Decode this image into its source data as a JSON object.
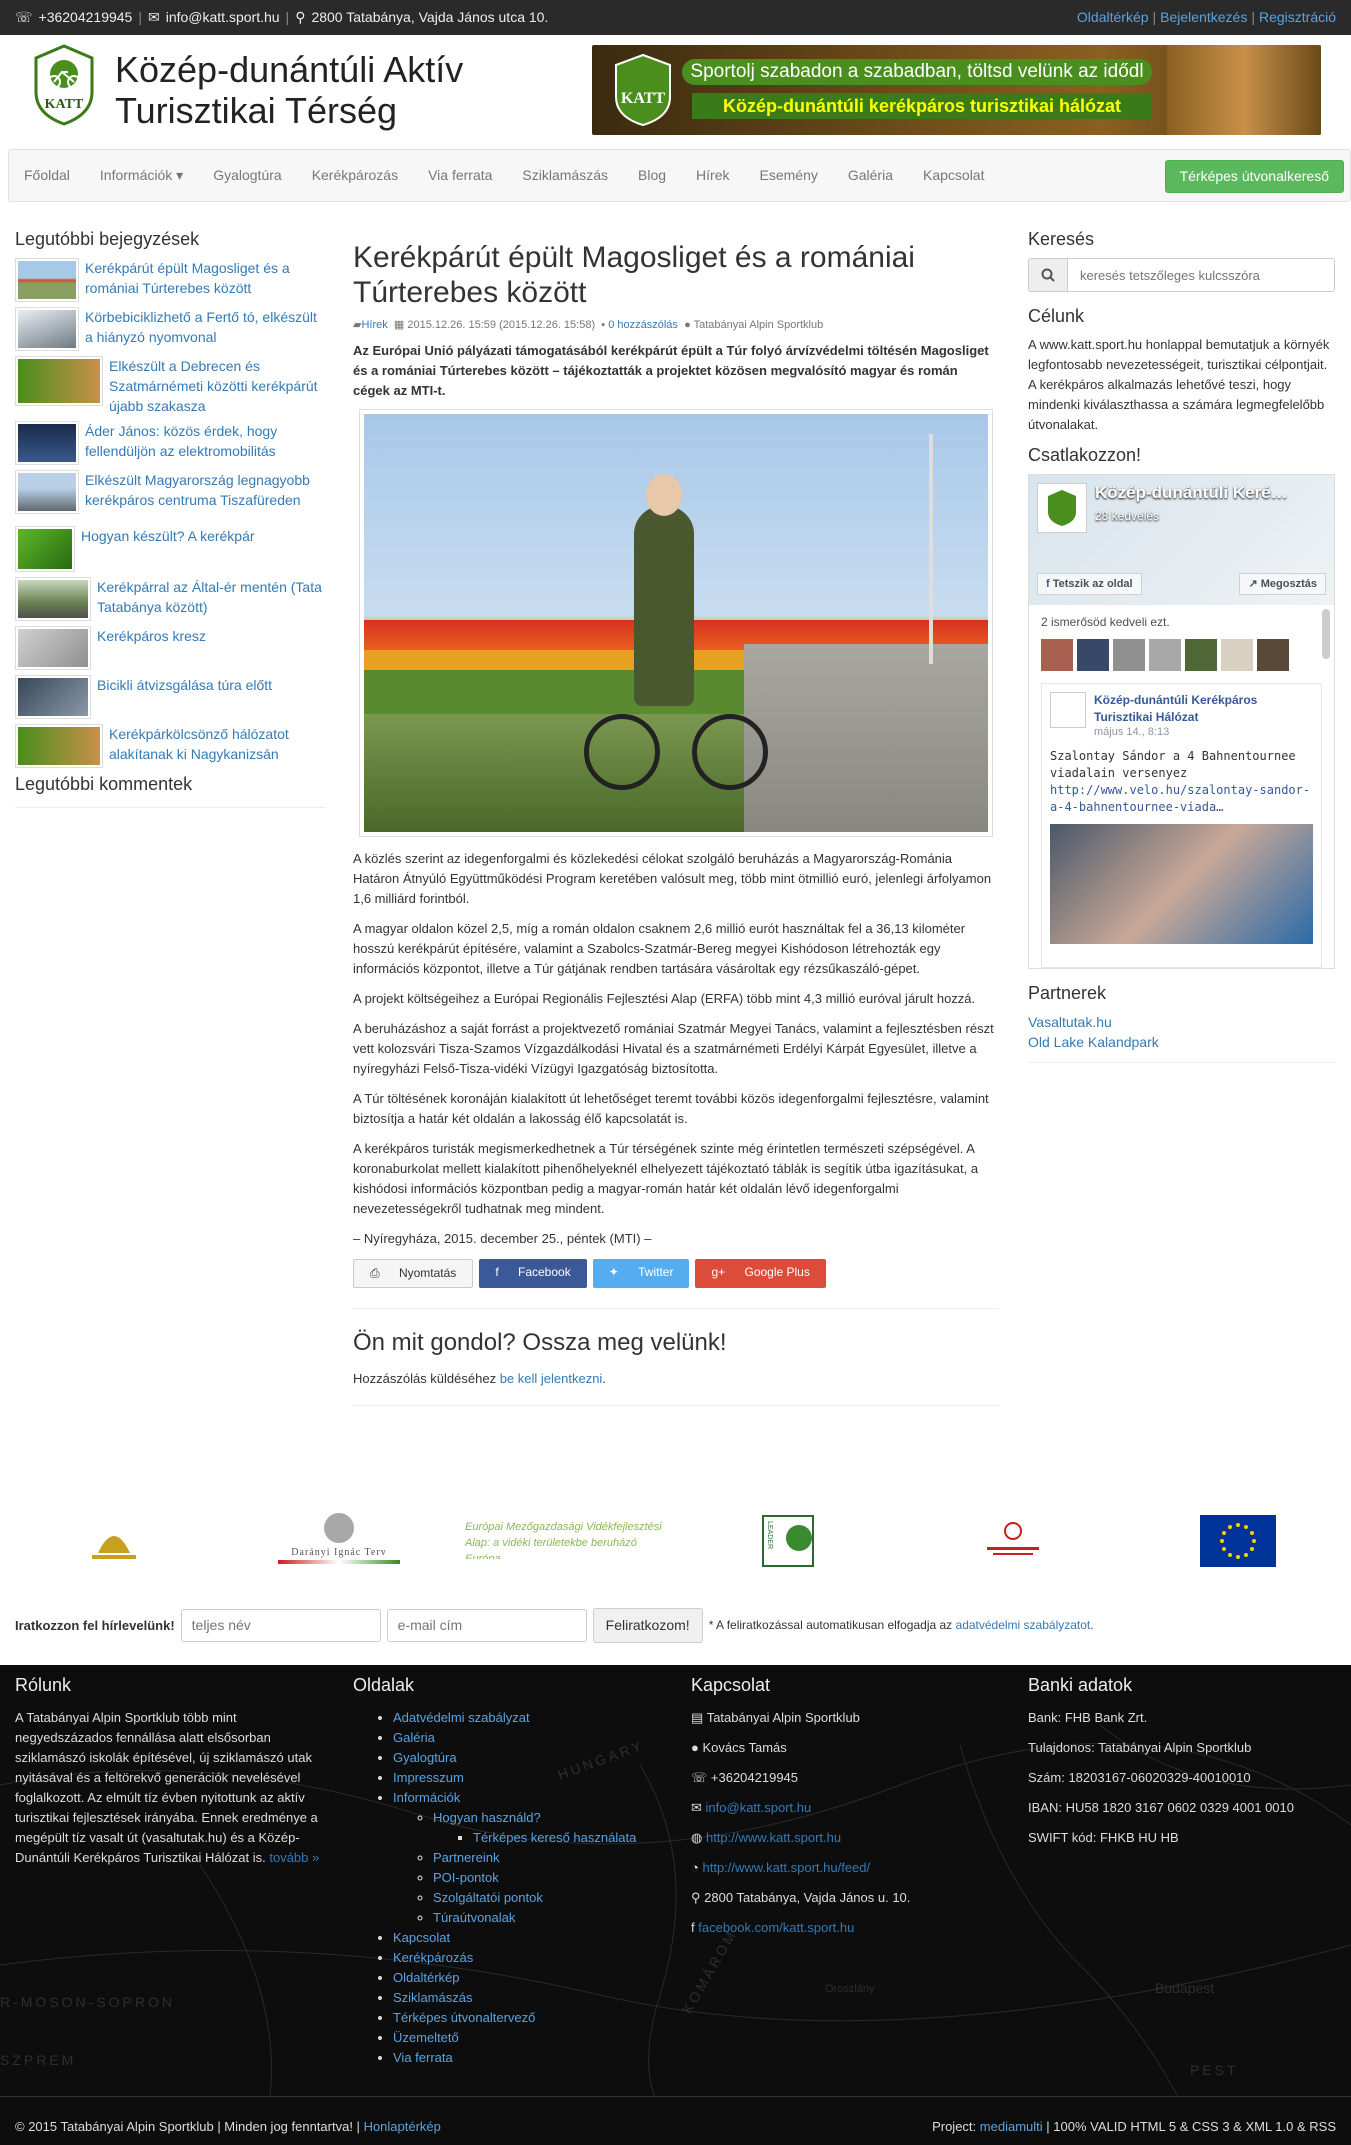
{
  "topbar": {
    "phone": "+36204219945",
    "email": "info@katt.sport.hu",
    "address": "2800 Tatabánya, Vajda János utca 10.",
    "links": [
      "Oldaltérkép",
      "Bejelentkezés",
      "Regisztráció"
    ]
  },
  "header": {
    "logo_text": "KATT",
    "title_line1": "Közép-dunántúli Aktív",
    "title_line2": "Turisztikai Térség",
    "banner_line1": "Sportolj szabadon a szabadban, töltsd velünk az idődl",
    "banner_line2": "Közép-dunántúli kerékpáros turisztikai hálózat",
    "banner_logo": "KATT"
  },
  "nav": {
    "items": [
      "Főoldal",
      "Információk ▾",
      "Gyalogtúra",
      "Kerékpározás",
      "Via ferrata",
      "Sziklamászás",
      "Blog",
      "Hírek",
      "Esemény",
      "Galéria",
      "Kapcsolat"
    ],
    "cta": "Térképes útvonalkereső"
  },
  "sidebar_left": {
    "recent_title": "Legutóbbi bejegyzések",
    "posts": [
      "Kerékpárút épült Magosliget és a romániai Túrterebes között",
      "Körbebiciklizhető a Fertő tó, elkészült a hiányzó nyomvonal",
      "Elkészült a Debrecen és Szatmárnémeti közötti kerékpárút újabb szakasza",
      "Áder János: közös érdek, hogy fellendüljön az elektromobilitás",
      "Elkészült Magyarország legnagyobb kerékpáros centruma Tiszafüreden",
      "Hogyan készült? A kerékpár",
      "Kerékpárral az Által-ér mentén (Tata Tatabánya között)",
      "Kerékpáros kresz",
      "Bicikli átvizsgálása túra előtt",
      "Kerékpárkölcsönző hálózatot alakítanak ki Nagykanizsán"
    ],
    "comments_title": "Legutóbbi kommentek"
  },
  "article": {
    "title": "Kerékpárút épült Magosliget és a romániai Túrterebes között",
    "category": "Hírek",
    "date": "2015.12.26. 15:59 (2015.12.26. 15:58)",
    "comments": "0 hozzászólás",
    "author": "Tatabányai Alpin Sportklub",
    "lead": "Az Európai Unió pályázati támogatásából kerékpárút épült a Túr folyó árvízvédelmi töltésén Magosliget és a romániai Túrterebes között – tájékoztatták a projektet közösen megvalósító magyar és román cégek az MTI-t.",
    "paragraphs": [
      "A közlés szerint az idegenforgalmi és közlekedési célokat szolgáló beruházás a Magyarország-Románia Határon Átnyúló Együttműködési Program keretében valósult meg, több mint ötmillió euró, jelenlegi árfolyamon 1,6 milliárd forintból.",
      "A magyar oldalon közel 2,5, míg a román oldalon csaknem 2,6 millió eurót használtak fel a 36,13 kilométer hosszú kerékpárút építésére, valamint a Szabolcs-Szatmár-Bereg megyei Kishódoson létrehozták egy információs központot, illetve a Túr gátjának rendben tartására vásároltak egy rézsűkaszáló-gépet.",
      "A projekt költségeihez a Európai Regionális Fejlesztési Alap (ERFA) több mint 4,3 millió euróval járult hozzá.",
      "A beruházáshoz a saját forrást a projektvezető romániai Szatmár Megyei Tanács, valamint a fejlesztésben részt vett kolozsvári Tisza-Szamos Vízgazdálkodási Hivatal és a szatmárnémeti Erdélyi Kárpát Egyesület, illetve a nyíregyházi Felső-Tisza-vidéki Vízügyi Igazgatóság biztosította.",
      "A Túr töltésének koronáján kialakított út lehetőséget teremt további közös idegenforgalmi fejlesztésre, valamint biztosítja a határ két oldalán a lakosság élő kapcsolatát is.",
      "A kerékpáros turisták megismerkedhetnek a Túr térségének szinte még érintetlen természeti szépségével. A koronaburkolat mellett kialakított pihenőhelyeknél elhelyezett tájékoztató táblák is segítik útba igazításukat, a kishódosi információs központban pedig a magyar-román határ két oldalán lévő idegenforgalmi nevezetességekről tudhatnak meg mindent.",
      "– Nyíregyháza, 2015. december 25., péntek (MTI) –"
    ],
    "share": [
      "Nyomtatás",
      "Facebook",
      "Twitter",
      "Google Plus"
    ],
    "comment_title": "Ön mit gondol? Ossza meg velünk!",
    "comment_text": "Hozzászólás küldéséhez",
    "comment_link": "be kell jelentkezni",
    "comment_end": "."
  },
  "sidebar_right": {
    "search_title": "Keresés",
    "search_placeholder": "keresés tetszőleges kulcsszóra",
    "aim_title": "Célunk",
    "aim_text": "A www.katt.sport.hu honlappal bemutatjuk a környék legfontosabb nevezetességeit, turisztikai célpontjait. A kerékpáros alkalmazás lehetővé teszi, hogy mindenki kiválaszthassa a számára legmegfelelőbb útvonalakat.",
    "join_title": "Csatlakozzon!",
    "fb": {
      "page_name": "Közép-dunántúli Keré…",
      "likes": "28 kedvelés",
      "like_btn": "Tetszik az oldal",
      "share_btn": "Megosztás",
      "friends": "2 ismerősöd kedveli ezt.",
      "post_name": "Közép-dunántúli Kerékpáros Turisztikai Hálózat",
      "post_date": "május 14., 8:13",
      "post_text": "Szalontay Sándor a 4 Bahnentournee viadalain versenyez",
      "post_link": "http://www.velo.hu/szalontay-sandor-a-4-bahnentournee-viada…"
    },
    "partners_title": "Partnerek",
    "partners": [
      "Vasaltutak.hu",
      "Old Lake Kalandpark"
    ]
  },
  "logos": [
    "Darányi Ignác Terv",
    "Európai Mezőgazdasági Vidékfejlesztési Alap: a vidéki területekbe beruházó Európa",
    "LEADER"
  ],
  "newsletter": {
    "label": "Iratkozzon fel hírlevelünk!",
    "name_ph": "teljes név",
    "email_ph": "e-mail cím",
    "button": "Feliratkozom!",
    "note": "* A feliratkozással automatikusan elfogadja az",
    "note_link": "adatvédelmi szabályzatot",
    "note_end": "."
  },
  "footer": {
    "about_title": "Rólunk",
    "about_text": "A Tatabányai Alpin Sportklub több mint negyedszázados fennállása alatt elsősorban sziklamászó iskolák építésével, új sziklamászó utak nyitásával és a feltörekvő generációk nevelésével foglalkozott. Az elmúlt tíz évben nyitottunk az aktív turisztikai fejlesztések irányába. Ennek eredménye a megépült tíz vasalt út (vasaltutak.hu) és a Közép-Dunántúli Kerékpáros Turisztikai Hálózat is.",
    "about_more": "tovább »",
    "pages_title": "Oldalak",
    "pages": [
      "Adatvédelmi szabályzat",
      "Galéria",
      "Gyalogtúra",
      "Impresszum",
      "Információk"
    ],
    "pages_sub1": "Hogyan használd?",
    "pages_sub2": "Térképes kereső használata",
    "pages_sub_rest": [
      "Partnereink",
      "POI-pontok",
      "Szolgáltatói pontok",
      "Túraútvonalak"
    ],
    "pages_rest": [
      "Kapcsolat",
      "Kerékpározás",
      "Oldaltérkép",
      "Sziklamászás",
      "Térképes útvonaltervező",
      "Üzemeltető",
      "Via ferrata"
    ],
    "contact_title": "Kapcsolat",
    "contact": [
      "Tatabányai Alpin Sportklub",
      "Kovács Tamás",
      "+36204219945",
      "info@katt.sport.hu",
      "http://www.katt.sport.hu",
      "http://www.katt.sport.hu/feed/",
      "2800 Tatabánya, Vajda János u. 10.",
      "facebook.com/katt.sport.hu"
    ],
    "bank_title": "Banki adatok",
    "bank": [
      "Bank: FHB Bank Zrt.",
      "Tulajdonos: Tatabányai Alpin Sportklub",
      "Szám: 18203167-06020329-40010010",
      "IBAN: HU58 1820 3167 0602 0329 4001 0010",
      "SWIFT kód: FHKB HU HB"
    ],
    "map_words": [
      "HUNGARY",
      "R-MOSON-SOPRON",
      "SZPREM",
      "KOMÁROM",
      "Budapest",
      "Oroszlány",
      "PEST"
    ]
  },
  "copyright": {
    "text": "© 2015 Tatabányai Alpin Sportklub | Minden jog fenntartva! |",
    "link": "Honlaptérkép",
    "right_pre": "Project:",
    "right_link": "mediamulti",
    "right_post": "| 100% VALID HTML 5 & CSS 3 & XML 1.0 & RSS"
  },
  "colors": {
    "accent": "#337ab7",
    "cta": "#5cb85c",
    "topbar": "#2a2a2a",
    "footer": "#0d0d0d"
  }
}
